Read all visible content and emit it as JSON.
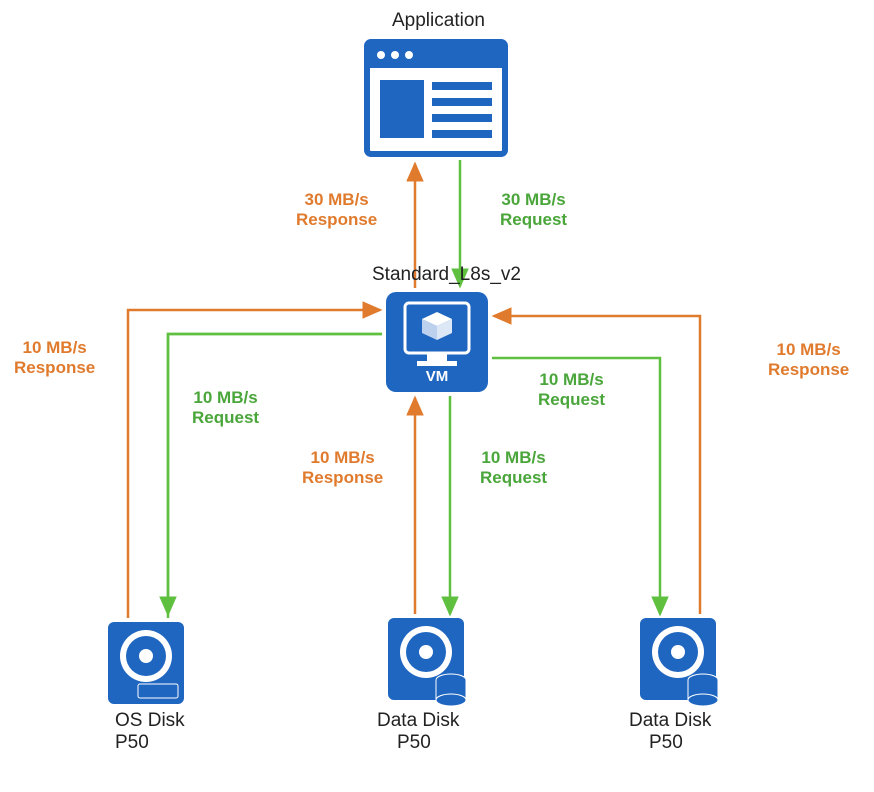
{
  "title_app": "Application",
  "title_vm": "Standard_L8s_v2",
  "vm_label": "VM",
  "app_to_vm_response": "30 MB/s\nResponse",
  "app_to_vm_request": "30 MB/s\nRequest",
  "os_disk": {
    "label": "OS Disk",
    "tier": "P50",
    "request": "10 MB/s\nRequest",
    "response": "10 MB/s\nResponse"
  },
  "data_disk_1": {
    "label": "Data Disk",
    "tier": "P50",
    "request": "10 MB/s\nRequest",
    "response": "10 MB/s\nResponse"
  },
  "data_disk_2": {
    "label": "Data Disk",
    "tier": "P50",
    "request": "10 MB/s\nRequest",
    "response": "10 MB/s\nResponse"
  },
  "colors": {
    "azure_blue": "#1f66c1",
    "orange": "#e07b2e",
    "green": "#5fbf3f"
  }
}
